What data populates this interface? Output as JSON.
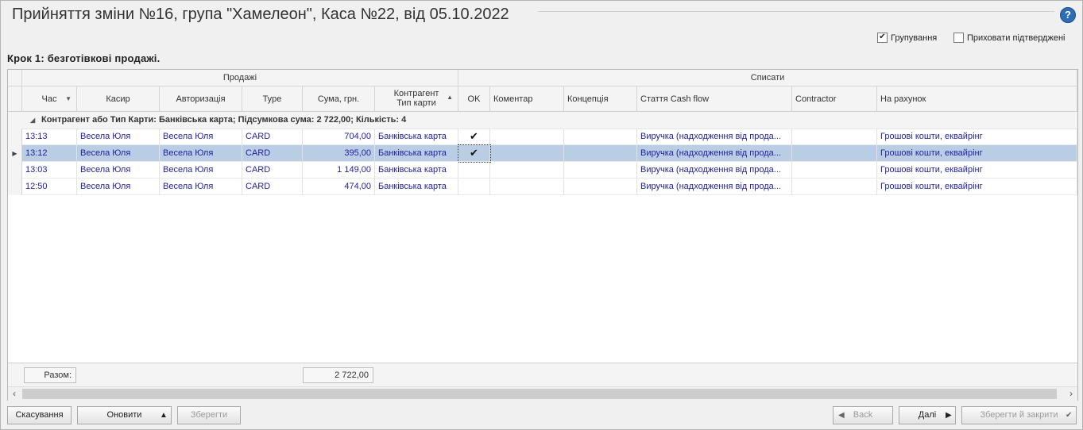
{
  "window": {
    "title": "Прийняття зміни №16, група \"Хамелеон\", Каса №22, від 05.10.2022"
  },
  "options": {
    "grouping_label": "Групування",
    "grouping_checked": true,
    "hide_confirmed_label": "Приховати підтверджені",
    "hide_confirmed_checked": false
  },
  "step_label": "Крок 1: безготівкові продажі.",
  "grid": {
    "band_sales": "Продажі",
    "band_writeoff": "Списати",
    "columns": {
      "time": "Час",
      "cashier": "Касир",
      "auth": "Авторизація",
      "type": "Type",
      "sum": "Сума, грн.",
      "contractor_line1": "Контрагент",
      "contractor_line2": "Тип карти",
      "ok": "OK",
      "comment": "Коментар",
      "concept": "Концепція",
      "cashflow": "Стаття Cash flow",
      "contractor": "Contractor",
      "account": "На рахунок"
    },
    "group_row": "Контрагент або Тип Карти: Банківська карта; Підсумкова сума: 2 722,00; Кількість: 4",
    "rows": [
      {
        "time": "13:13",
        "cashier": "Весела Юля",
        "auth": "Весела Юля",
        "type": "CARD",
        "sum": "704,00",
        "contractor": "Банківська карта",
        "ok": "✔",
        "comment": "",
        "concept": "",
        "cashflow": "Виручка (надходження від прода...",
        "contractor2": "",
        "account": "Грошові кошти, еквайрінг"
      },
      {
        "time": "13:12",
        "cashier": "Весела Юля",
        "auth": "Весела Юля",
        "type": "CARD",
        "sum": "395,00",
        "contractor": "Банківська карта",
        "ok": "✔",
        "comment": "",
        "concept": "",
        "cashflow": "Виручка (надходження від прода...",
        "contractor2": "",
        "account": "Грошові кошти, еквайрінг"
      },
      {
        "time": "13:03",
        "cashier": "Весела Юля",
        "auth": "Весела Юля",
        "type": "CARD",
        "sum": "1 149,00",
        "contractor": "Банківська карта",
        "ok": "",
        "comment": "",
        "concept": "",
        "cashflow": "Виручка (надходження від прода...",
        "contractor2": "",
        "account": "Грошові кошти, еквайрінг"
      },
      {
        "time": "12:50",
        "cashier": "Весела Юля",
        "auth": "Весела Юля",
        "type": "CARD",
        "sum": "474,00",
        "contractor": "Банківська карта",
        "ok": "",
        "comment": "",
        "concept": "",
        "cashflow": "Виручка (надходження від прода...",
        "contractor2": "",
        "account": "Грошові кошти, еквайрінг"
      }
    ],
    "footer_total_label": "Разом:",
    "footer_total_value": "2 722,00"
  },
  "buttons": {
    "cancel": "Скасування",
    "refresh": "Оновити",
    "save": "Зберегти",
    "back": "Back",
    "next": "Далі",
    "save_close": "Зберегти й закрити"
  },
  "colors": {
    "selected_row": "#b9cde5",
    "data_text": "#1f1f9e",
    "help_icon": "#2e6db5"
  }
}
